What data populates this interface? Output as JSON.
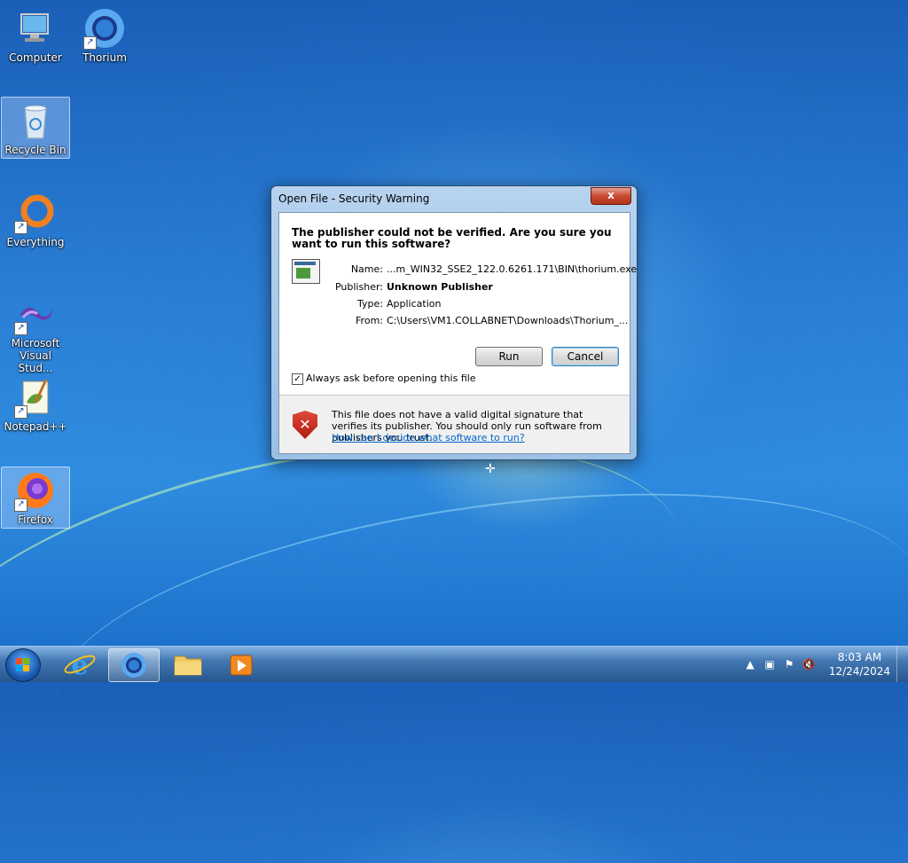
{
  "desktop": {
    "icons": [
      {
        "label": "Computer"
      },
      {
        "label": "Thorium"
      },
      {
        "label": "Recycle Bin"
      },
      {
        "label": "Everything"
      },
      {
        "label": "Microsoft Visual Stud..."
      },
      {
        "label": "Notepad++"
      },
      {
        "label": "Firefox"
      }
    ]
  },
  "dialog": {
    "title": "Open File - Security Warning",
    "close_label": "x",
    "headline": "The publisher could not be verified.  Are you sure you want to run this software?",
    "fields": [
      {
        "label": "Name:",
        "value": "...m_WIN32_SSE2_122.0.6261.171\\BIN\\thorium.exe"
      },
      {
        "label": "Publisher:",
        "value": "Unknown Publisher"
      },
      {
        "label": "Type:",
        "value": "Application"
      },
      {
        "label": "From:",
        "value": "C:\\Users\\VM1.COLLABNET\\Downloads\\Thorium_..."
      }
    ],
    "run_label": "Run",
    "cancel_label": "Cancel",
    "checkbox_label": "Always ask before opening this file",
    "checkbox_checked": true,
    "warning_text": "This file does not have a valid digital signature that verifies its publisher.  You should only run software from publishers you trust.",
    "help_link": "How can I decide what software to run?"
  },
  "taskbar": {
    "time": "8:03 AM",
    "date": "12/24/2024"
  },
  "colors": {
    "link": "#0066cc",
    "close_button": "#c74a32"
  }
}
